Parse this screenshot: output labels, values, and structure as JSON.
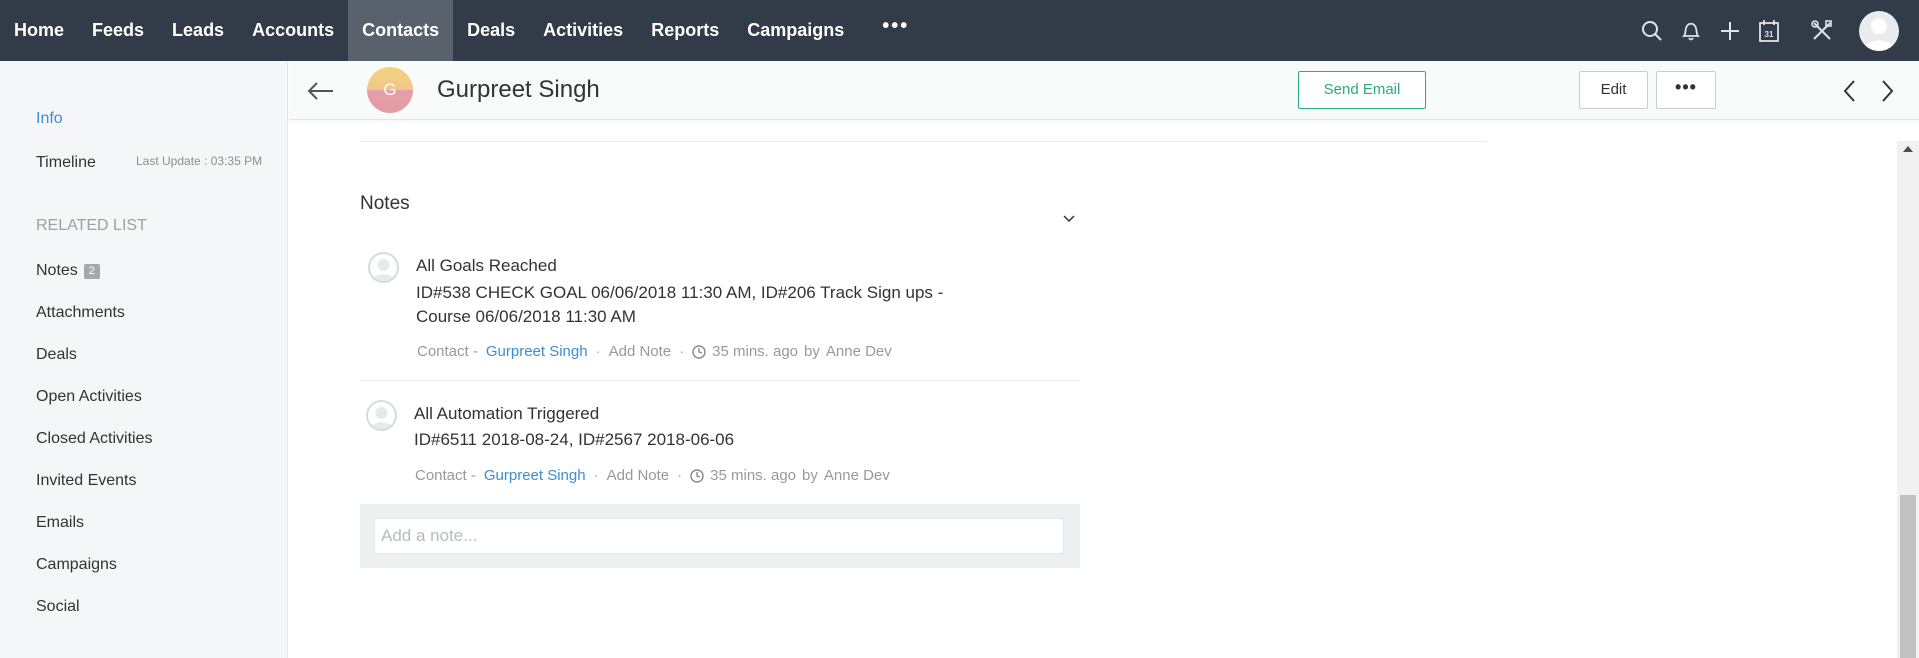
{
  "topnav": {
    "items": [
      {
        "label": "Home"
      },
      {
        "label": "Feeds"
      },
      {
        "label": "Leads"
      },
      {
        "label": "Accounts"
      },
      {
        "label": "Contacts",
        "active": true
      },
      {
        "label": "Deals"
      },
      {
        "label": "Activities"
      },
      {
        "label": "Reports"
      },
      {
        "label": "Campaigns"
      }
    ],
    "more_label": "•••",
    "icons": [
      "search-icon",
      "bell-icon",
      "plus-icon",
      "calendar-icon",
      "tools-icon"
    ],
    "calendar_day": "31"
  },
  "sidebar": {
    "info_label": "Info",
    "timeline_label": "Timeline",
    "last_update": "Last Update : 03:35 PM",
    "related_heading": "RELATED LIST",
    "notes_label": "Notes",
    "notes_count": "2",
    "items": [
      "Attachments",
      "Deals",
      "Open Activities",
      "Closed Activities",
      "Invited Events",
      "Emails",
      "Campaigns",
      "Social"
    ]
  },
  "record": {
    "avatar_letter": "G",
    "name": "Gurpreet Singh",
    "send_email_label": "Send Email",
    "edit_label": "Edit",
    "more_label": "•••"
  },
  "notes": {
    "title": "Notes",
    "items": [
      {
        "title": "All Goals Reached",
        "body_line1": "ID#538 CHECK GOAL 06/06/2018 11:30 AM, ID#206 Track Sign ups -",
        "body_line2": "Course 06/06/2018 11:30 AM",
        "meta_prefix": "Contact -",
        "meta_link": "Gurpreet Singh",
        "add_note": "Add Note",
        "time": "35 mins. ago",
        "by": "by",
        "author": "Anne Dev"
      },
      {
        "title": "All Automation Triggered",
        "body_line1": "ID#6511  2018-08-24, ID#2567  2018-06-06",
        "meta_prefix": "Contact -",
        "meta_link": "Gurpreet Singh",
        "add_note": "Add Note",
        "time": "35 mins. ago",
        "by": "by",
        "author": "Anne Dev"
      }
    ],
    "add_placeholder": "Add a note..."
  },
  "colors": {
    "topnav_bg": "#323b48",
    "active_tab": "#59616d",
    "accent_blue": "#3b8ed3",
    "send_email_green": "#2aaa82"
  }
}
